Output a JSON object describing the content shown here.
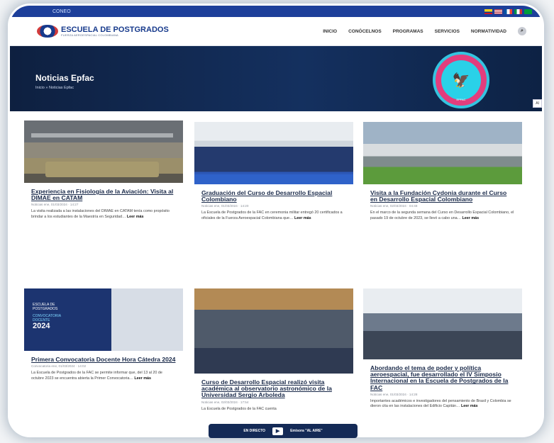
{
  "topbar": {
    "left_text": "CONEO"
  },
  "header": {
    "logo_title": "ESCUELA DE POSTGRADOS",
    "logo_sub": "FUERZA AEROESPACIAL COLOMBIANA",
    "nav": [
      "INICIO",
      "CONÓCELNOS",
      "PROGRAMAS",
      "SERVICIOS",
      "NORMATIVIDAD"
    ]
  },
  "hero": {
    "title": "Noticias Epfac",
    "breadcrumb": "Inicio  »  Noticias Epfac",
    "badge_label": "EPFAC"
  },
  "side_tab": "AI",
  "cards": [
    {
      "title": "Experiencia en Fisiología de la Aviación: Visita al DIMAE en CATAM",
      "meta": "Noticias ene, 01/03/2024 · 14:27",
      "excerpt": "La visita realizada a las instalaciones del DIMAE en CATAM tenía como propósito brindar a los estudiantes de la Maestría en Seguridad…",
      "more": "Leer más"
    },
    {
      "title": "Graduación del Curso de Desarrollo Espacial Colombiano",
      "meta": "Noticias ene, 01/03/2024 · 14:20",
      "excerpt": "La Escuela de Postgrados de la FAC en ceremonia militar entregó 20 certificados a oficiales de la Fuerza Aeroespacial Colombiana que…",
      "more": "Leer más"
    },
    {
      "title": "Visita a la Fundación Cydonia durante el Curso en Desarrollo Espacial Colombiano",
      "meta": "Noticias ene, 02/03/2024 · 04:48",
      "excerpt": "En el marco de la segunda semana del Curso en Desarrollo Espacial Colombiano, el pasado 19 de octubre de 2023, se llevó a cabo una…",
      "more": "Leer más"
    },
    {
      "title": "Primera Convocatoria Docente Hora Cátedra 2024",
      "meta": "Convocatoria ene, 01/03/2024 · 14:02",
      "excerpt": "La Escuela de Postgrados de la FAC se permite informar que, del 13 al 20 de octubre 2023 se encuentra abierta la Primer Convocatoria…",
      "more": "Leer más"
    },
    {
      "title": "Curso de Desarrollo Espacial realizó visita académica al observatorio astronómico de la Universidad Sergio Arboleda",
      "meta": "Noticias ene, 02/03/2024 · 17:54",
      "excerpt": "La Escuela de Postgrados de la FAC cuenta",
      "more": ""
    },
    {
      "title": "Abordando el tema de poder y política aeroespacial, fue desarrollado el IV Simposio Internacional en la Escuela de Postgrados de la FAC",
      "meta": "Noticias ene, 01/03/2024 · 14:28",
      "excerpt": "Importantes académicos e investigadores del pensamiento de Brasil y Colombia se dieron cita en las instalaciones del Edificio Capitán…",
      "more": "Leer más"
    }
  ],
  "card4_overlay": {
    "line1": "ESCUELA DE POSTGRADOS",
    "line2": "CONVOCATORIA DOCENTE",
    "year": "2024"
  },
  "live": {
    "left": "EN DIRECTO",
    "right": "Emisora \"AL AIRE\""
  }
}
